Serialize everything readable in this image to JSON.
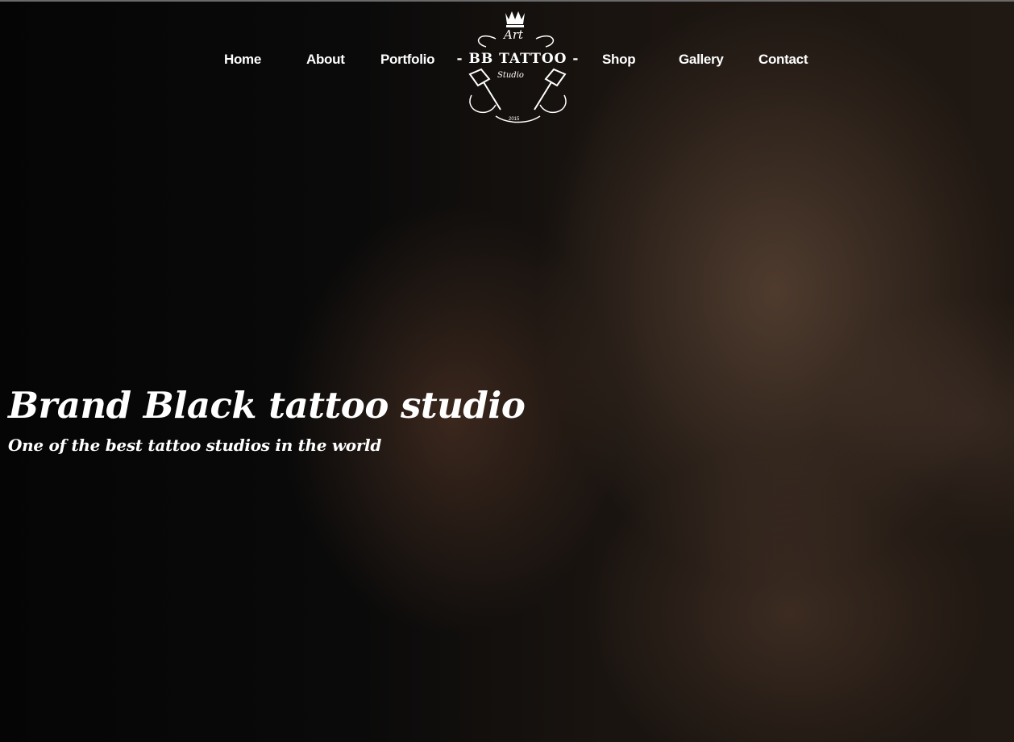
{
  "nav": {
    "items": [
      "Home",
      "About",
      "Portfolio",
      "Shop",
      "Gallery",
      "Contact"
    ]
  },
  "logo": {
    "top_word": "Art",
    "name": "- BB TATTOO -",
    "sub_word": "Studio",
    "year": "2015",
    "icons": [
      "crown-icon",
      "tattoo-machine-icon"
    ]
  },
  "hero": {
    "title": "Brand Black tattoo studio",
    "subtitle": "One of the best tattoo studios in the world",
    "image": "tattooed-man-portrait"
  }
}
